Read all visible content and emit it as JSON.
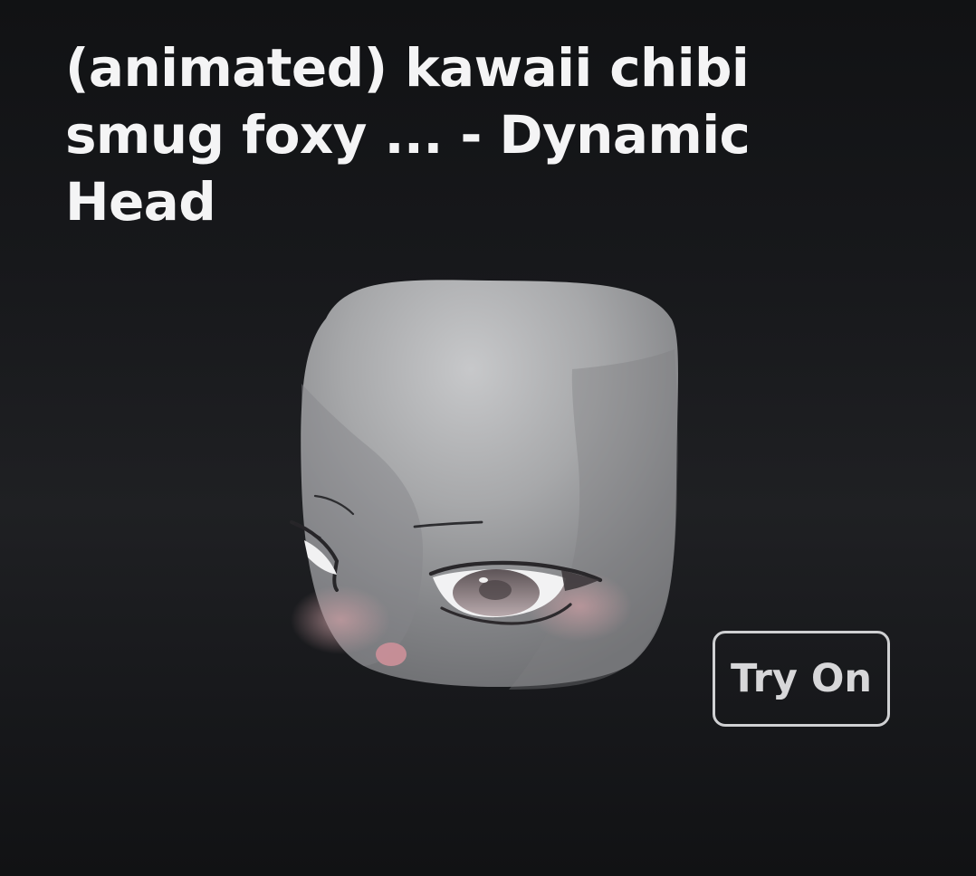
{
  "item": {
    "title": "(animated) kawaii chibi smug foxy ... - Dynamic Head"
  },
  "actions": {
    "try_on_label": "Try On"
  },
  "preview": {
    "head_color": "#9a9b9d",
    "blush_color": "#c99da2"
  }
}
